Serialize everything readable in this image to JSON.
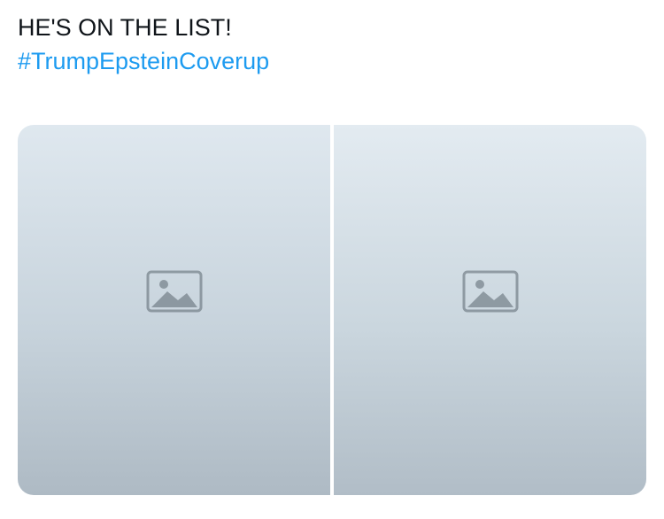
{
  "post": {
    "text_line": "HE'S ON THE LIST!",
    "hashtag": "#TrumpEpsteinCoverup"
  },
  "media": {
    "photos": [
      {
        "icon": "image-icon"
      },
      {
        "icon": "image-icon"
      }
    ]
  }
}
